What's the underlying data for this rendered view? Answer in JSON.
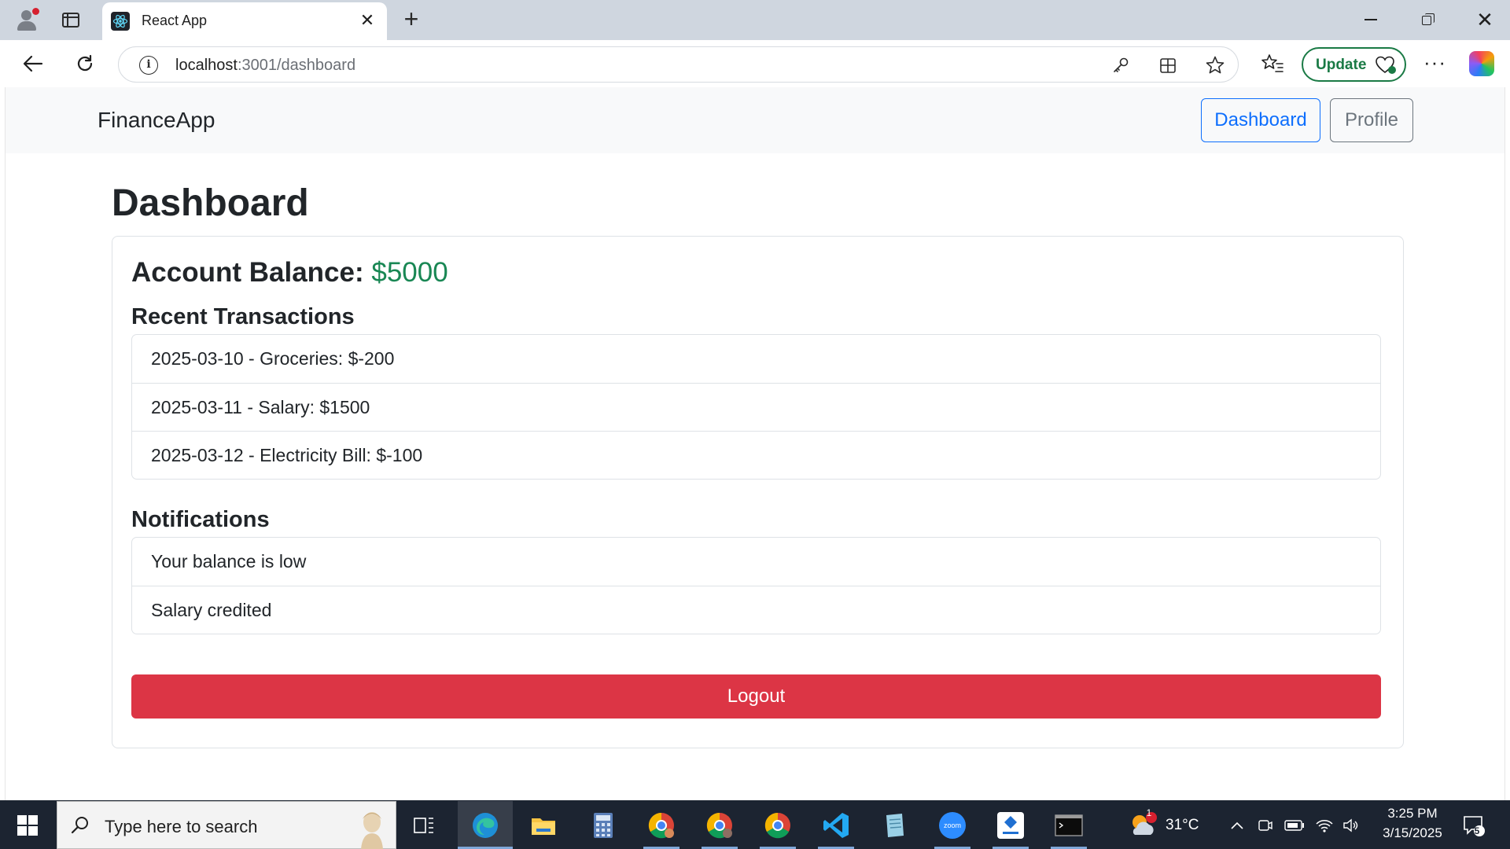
{
  "browser": {
    "tab_title": "React App",
    "address_host": "localhost",
    "address_path": ":3001/dashboard",
    "update_label": "Update",
    "more_label": "···"
  },
  "navbar": {
    "brand": "FinanceApp",
    "links": [
      {
        "label": "Dashboard",
        "active": true
      },
      {
        "label": "Profile",
        "active": false
      }
    ]
  },
  "page": {
    "title": "Dashboard",
    "balance_label": "Account Balance:",
    "balance_value": "$5000",
    "transactions_heading": "Recent Transactions",
    "transactions": [
      "2025-03-10 - Groceries: $-200",
      "2025-03-11 - Salary: $1500",
      "2025-03-12 - Electricity Bill: $-100"
    ],
    "notifications_heading": "Notifications",
    "notifications": [
      "Your balance is low",
      "Salary credited"
    ],
    "logout_label": "Logout"
  },
  "taskbar": {
    "search_placeholder": "Type here to search",
    "weather_temp": "31°C",
    "weather_badge": "1",
    "time": "3:25 PM",
    "date": "3/15/2025",
    "notification_count": "5"
  },
  "colors": {
    "primary": "#0d6efd",
    "secondary": "#6c757d",
    "success": "#198754",
    "danger": "#dc3545",
    "taskbar": "#1c2431"
  }
}
